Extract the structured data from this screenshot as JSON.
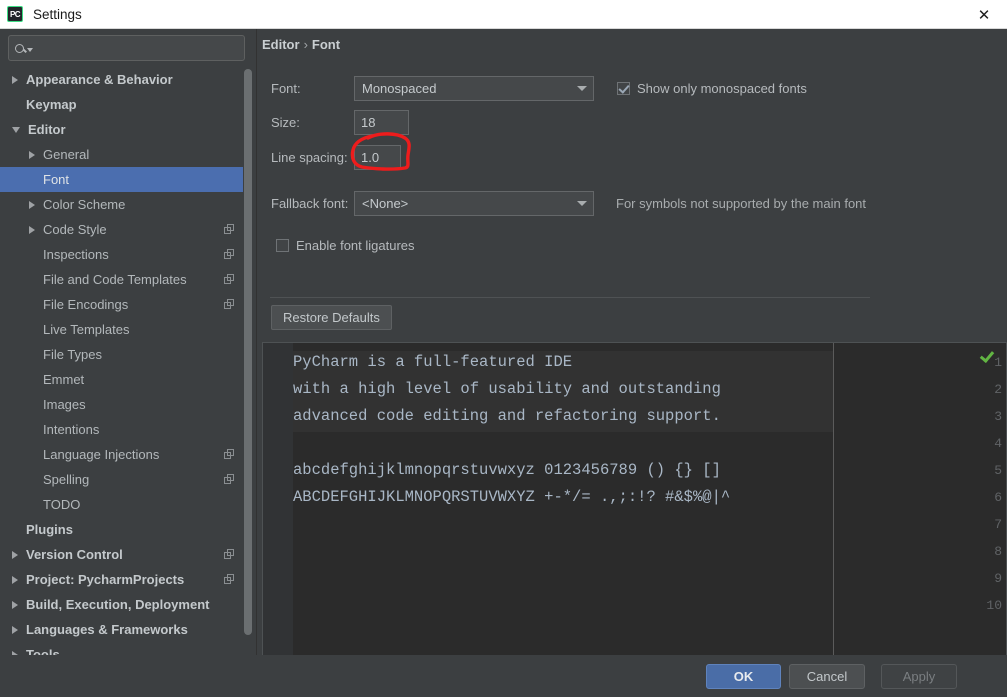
{
  "window": {
    "title": "Settings",
    "app_icon": "pycharm-logo-icon",
    "close_label": "✕"
  },
  "sidebar": {
    "search": {
      "placeholder": "",
      "value": "",
      "icon": "search-icon"
    },
    "items": [
      {
        "label": "Appearance & Behavior",
        "indent": 0,
        "arrow": "collapsed",
        "bold": true,
        "copy": false
      },
      {
        "label": "Keymap",
        "indent": 0,
        "arrow": "none",
        "bold": true,
        "copy": false
      },
      {
        "label": "Editor",
        "indent": 0,
        "arrow": "expanded",
        "bold": true,
        "copy": false
      },
      {
        "label": "General",
        "indent": 1,
        "arrow": "collapsed",
        "bold": false,
        "copy": false
      },
      {
        "label": "Font",
        "indent": 1,
        "arrow": "none",
        "bold": false,
        "copy": false,
        "selected": true
      },
      {
        "label": "Color Scheme",
        "indent": 1,
        "arrow": "collapsed",
        "bold": false,
        "copy": false
      },
      {
        "label": "Code Style",
        "indent": 1,
        "arrow": "collapsed",
        "bold": false,
        "copy": true
      },
      {
        "label": "Inspections",
        "indent": 1,
        "arrow": "none",
        "bold": false,
        "copy": true
      },
      {
        "label": "File and Code Templates",
        "indent": 1,
        "arrow": "none",
        "bold": false,
        "copy": true
      },
      {
        "label": "File Encodings",
        "indent": 1,
        "arrow": "none",
        "bold": false,
        "copy": true
      },
      {
        "label": "Live Templates",
        "indent": 1,
        "arrow": "none",
        "bold": false,
        "copy": false
      },
      {
        "label": "File Types",
        "indent": 1,
        "arrow": "none",
        "bold": false,
        "copy": false
      },
      {
        "label": "Emmet",
        "indent": 1,
        "arrow": "none",
        "bold": false,
        "copy": false
      },
      {
        "label": "Images",
        "indent": 1,
        "arrow": "none",
        "bold": false,
        "copy": false
      },
      {
        "label": "Intentions",
        "indent": 1,
        "arrow": "none",
        "bold": false,
        "copy": false
      },
      {
        "label": "Language Injections",
        "indent": 1,
        "arrow": "none",
        "bold": false,
        "copy": true
      },
      {
        "label": "Spelling",
        "indent": 1,
        "arrow": "none",
        "bold": false,
        "copy": true
      },
      {
        "label": "TODO",
        "indent": 1,
        "arrow": "none",
        "bold": false,
        "copy": false
      },
      {
        "label": "Plugins",
        "indent": 0,
        "arrow": "none",
        "bold": true,
        "copy": false
      },
      {
        "label": "Version Control",
        "indent": 0,
        "arrow": "collapsed",
        "bold": true,
        "copy": true
      },
      {
        "label": "Project: PycharmProjects",
        "indent": 0,
        "arrow": "collapsed",
        "bold": true,
        "copy": true
      },
      {
        "label": "Build, Execution, Deployment",
        "indent": 0,
        "arrow": "collapsed",
        "bold": true,
        "copy": false
      },
      {
        "label": "Languages & Frameworks",
        "indent": 0,
        "arrow": "collapsed",
        "bold": true,
        "copy": false
      },
      {
        "label": "Tools",
        "indent": 0,
        "arrow": "collapsed",
        "bold": true,
        "copy": false
      }
    ],
    "help_label": "?"
  },
  "main": {
    "breadcrumb": {
      "root": "Editor",
      "separator": "›",
      "current": "Font"
    },
    "font_label": "Font:",
    "font_value": "Monospaced",
    "monospaced_checkbox": {
      "label": "Show only monospaced fonts",
      "checked": true
    },
    "size_label": "Size:",
    "size_value": "18",
    "line_spacing_label": "Line spacing:",
    "line_spacing_value": "1.0",
    "fallback_label": "Fallback font:",
    "fallback_value": "<None>",
    "fallback_hint": "For symbols not supported by the main font",
    "ligatures_checkbox": {
      "label": "Enable font ligatures",
      "checked": false
    },
    "restore_defaults_label": "Restore Defaults",
    "preview": {
      "gutter_numbers": [
        "1",
        "2",
        "3",
        "4",
        "5",
        "6",
        "7",
        "8",
        "9",
        "10"
      ],
      "lines": [
        "PyCharm is a full-featured IDE",
        "with a high level of usability and outstanding",
        "advanced code editing and refactoring support.",
        "",
        "abcdefghijklmnopqrstuvwxyz 0123456789 () {} []",
        "ABCDEFGHIJKLMNOPQRSTUVWXYZ +-*/= .,;:!? #&$%@|^"
      ],
      "status_icon": "inspection-ok-check-icon"
    }
  },
  "footer": {
    "ok_label": "OK",
    "cancel_label": "Cancel",
    "apply_label": "Apply"
  },
  "annotation": {
    "type": "hand-drawn-circle",
    "color": "#ee1c1c",
    "target": "size-field"
  },
  "colors": {
    "dialog_bg": "#3c3f41",
    "selection_blue": "#4b6eaf",
    "primary_button": "#4a6da7",
    "editor_bg": "#2b2b2b",
    "gutter_bg": "#313335",
    "code_text": "#a9b7c6",
    "annotation_red": "#ee1c1c",
    "ok_check_green": "#62b543"
  }
}
